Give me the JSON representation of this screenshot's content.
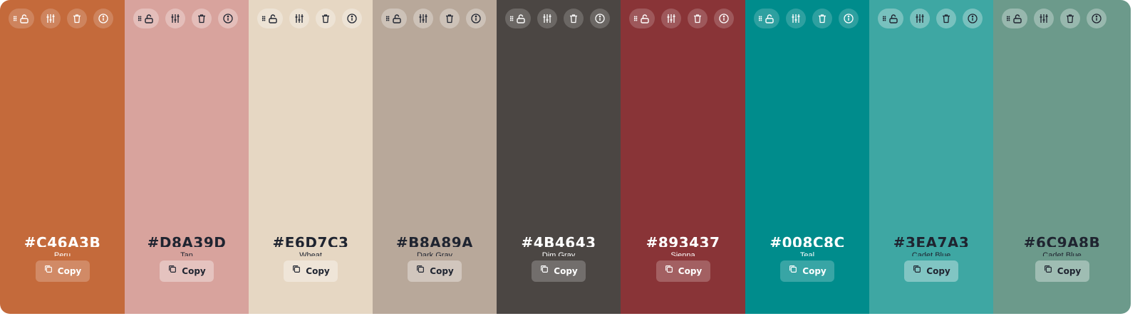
{
  "copy_label": "Copy",
  "swatches": [
    {
      "hex": "#C46A3B",
      "name": "Peru",
      "color": "#C46A3B",
      "text": "#ffffff",
      "theme": "dark",
      "width": 175
    },
    {
      "hex": "#D8A39D",
      "name": "Tan",
      "color": "#D8A39D",
      "text": "#1f2430",
      "theme": "light",
      "width": 174
    },
    {
      "hex": "#E6D7C3",
      "name": "Wheat",
      "color": "#E6D7C3",
      "text": "#1f2430",
      "theme": "light",
      "width": 174
    },
    {
      "hex": "#B8A89A",
      "name": "Dark Gray",
      "color": "#B8A89A",
      "text": "#1f2430",
      "theme": "light",
      "width": 174
    },
    {
      "hex": "#4B4643",
      "name": "Dim Gray",
      "color": "#4B4643",
      "text": "#ffffff",
      "theme": "dark",
      "width": 174
    },
    {
      "hex": "#893437",
      "name": "Sienna",
      "color": "#893437",
      "text": "#ffffff",
      "theme": "dark",
      "width": 175
    },
    {
      "hex": "#008C8C",
      "name": "Teal",
      "color": "#008C8C",
      "text": "#ffffff",
      "theme": "dark",
      "width": 174
    },
    {
      "hex": "#3EA7A3",
      "name": "Cadet Blue",
      "color": "#3EA7A3",
      "text": "#1f2430",
      "theme": "light",
      "width": 174
    },
    {
      "hex": "#6C9A8B",
      "name": "Cadet Blue",
      "color": "#6C9A8B",
      "text": "#1f2430",
      "theme": "light",
      "width": 193
    }
  ]
}
